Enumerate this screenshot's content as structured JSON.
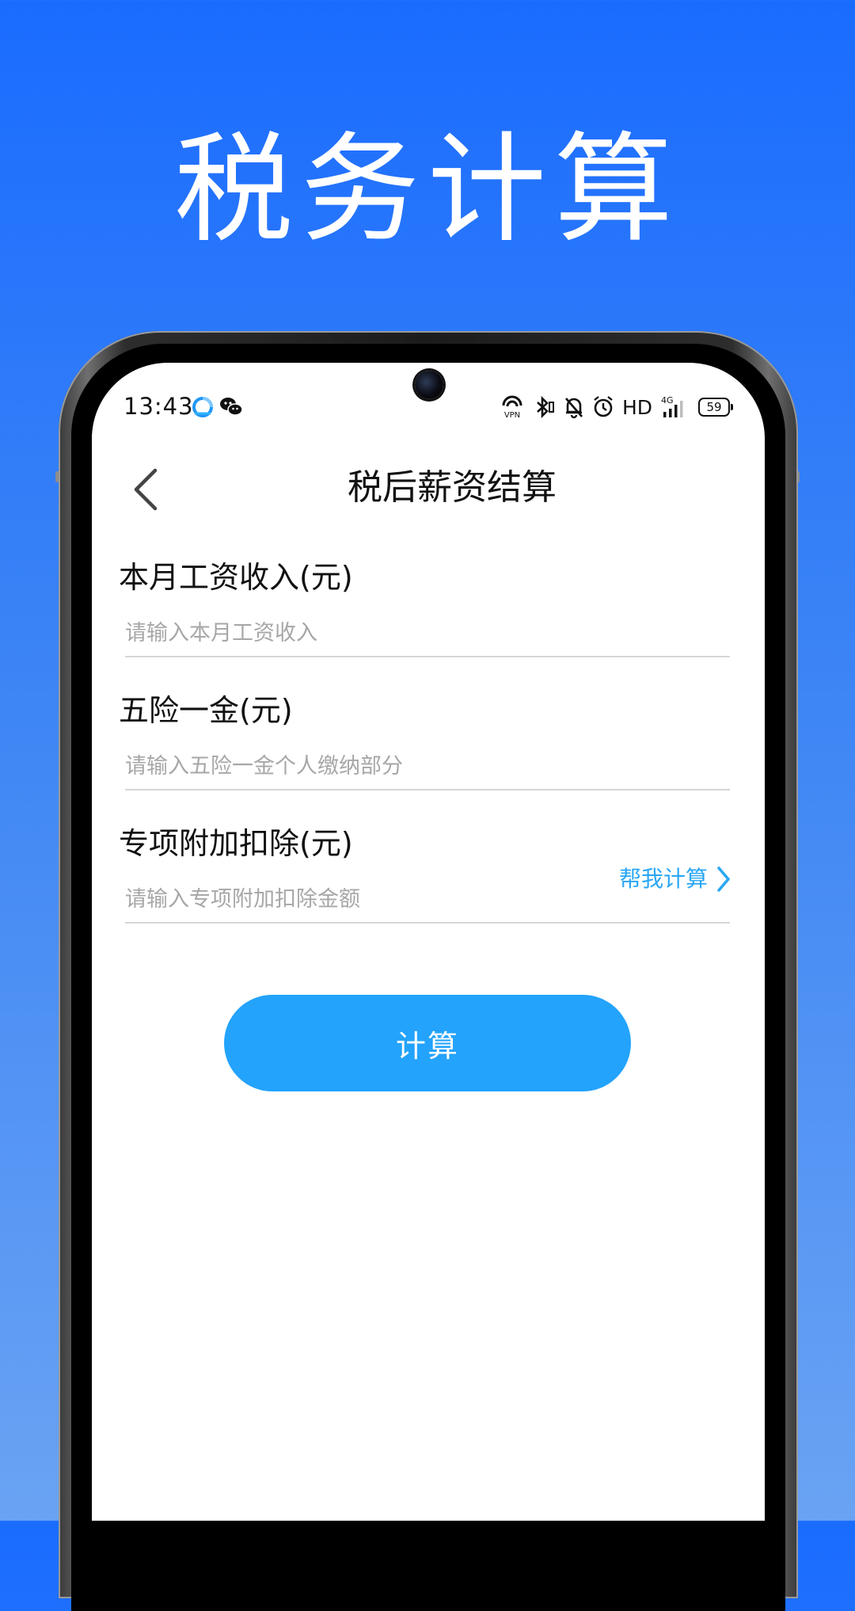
{
  "promo": {
    "title": "税务计算"
  },
  "status_bar": {
    "time": "13:43",
    "network_label": "HD",
    "signal_label": "4G",
    "vpn_label": "VPN",
    "battery": "59"
  },
  "header": {
    "title": "税后薪资结算"
  },
  "form": {
    "fields": [
      {
        "label": "本月工资收入(元)",
        "placeholder": "请输入本月工资收入",
        "value": ""
      },
      {
        "label": "五险一金(元)",
        "placeholder": "请输入五险一金个人缴纳部分",
        "value": ""
      },
      {
        "label": "专项附加扣除(元)",
        "placeholder": "请输入专项附加扣除金额",
        "value": ""
      }
    ],
    "help_link_label": "帮我计算",
    "submit_label": "计算"
  },
  "colors": {
    "background_top": "#1a6cff",
    "background_bottom": "#6aa3f3",
    "accent": "#23a3fc",
    "link": "#2aa7f5"
  }
}
